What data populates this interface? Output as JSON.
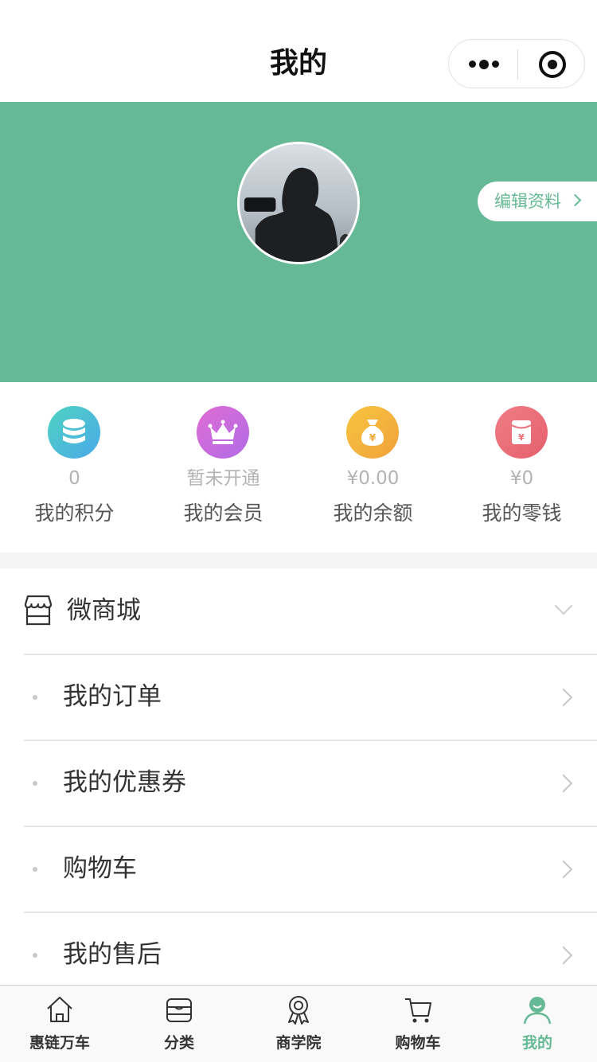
{
  "nav": {
    "title": "我的",
    "more_icon": "more-dots-icon",
    "close_icon": "target-circle-icon"
  },
  "profile": {
    "edit_label": "编辑资料",
    "banner_color": "#66b996"
  },
  "stats": [
    {
      "value": "0",
      "label": "我的积分",
      "icon": "coins-stack-icon",
      "color": "#4cc3c9"
    },
    {
      "value": "暂未开通",
      "label": "我的会员",
      "icon": "crown-icon",
      "color": "#c86be0"
    },
    {
      "value": "¥0.00",
      "label": "我的余额",
      "icon": "money-bag-icon",
      "color": "#f2b13a"
    },
    {
      "value": "¥0",
      "label": "我的零钱",
      "icon": "red-envelope-icon",
      "color": "#ea6f78"
    }
  ],
  "menu": {
    "section_label": "微商城",
    "items": [
      {
        "label": "我的订单"
      },
      {
        "label": "我的优惠券"
      },
      {
        "label": "购物车"
      },
      {
        "label": "我的售后"
      }
    ]
  },
  "tabbar": {
    "active_color": "#66b996",
    "tabs": [
      {
        "label": "惠链万车",
        "icon": "home-icon"
      },
      {
        "label": "分类",
        "icon": "category-box-icon"
      },
      {
        "label": "商学院",
        "icon": "award-ribbon-icon"
      },
      {
        "label": "购物车",
        "icon": "cart-icon"
      },
      {
        "label": "我的",
        "icon": "user-icon"
      }
    ]
  }
}
